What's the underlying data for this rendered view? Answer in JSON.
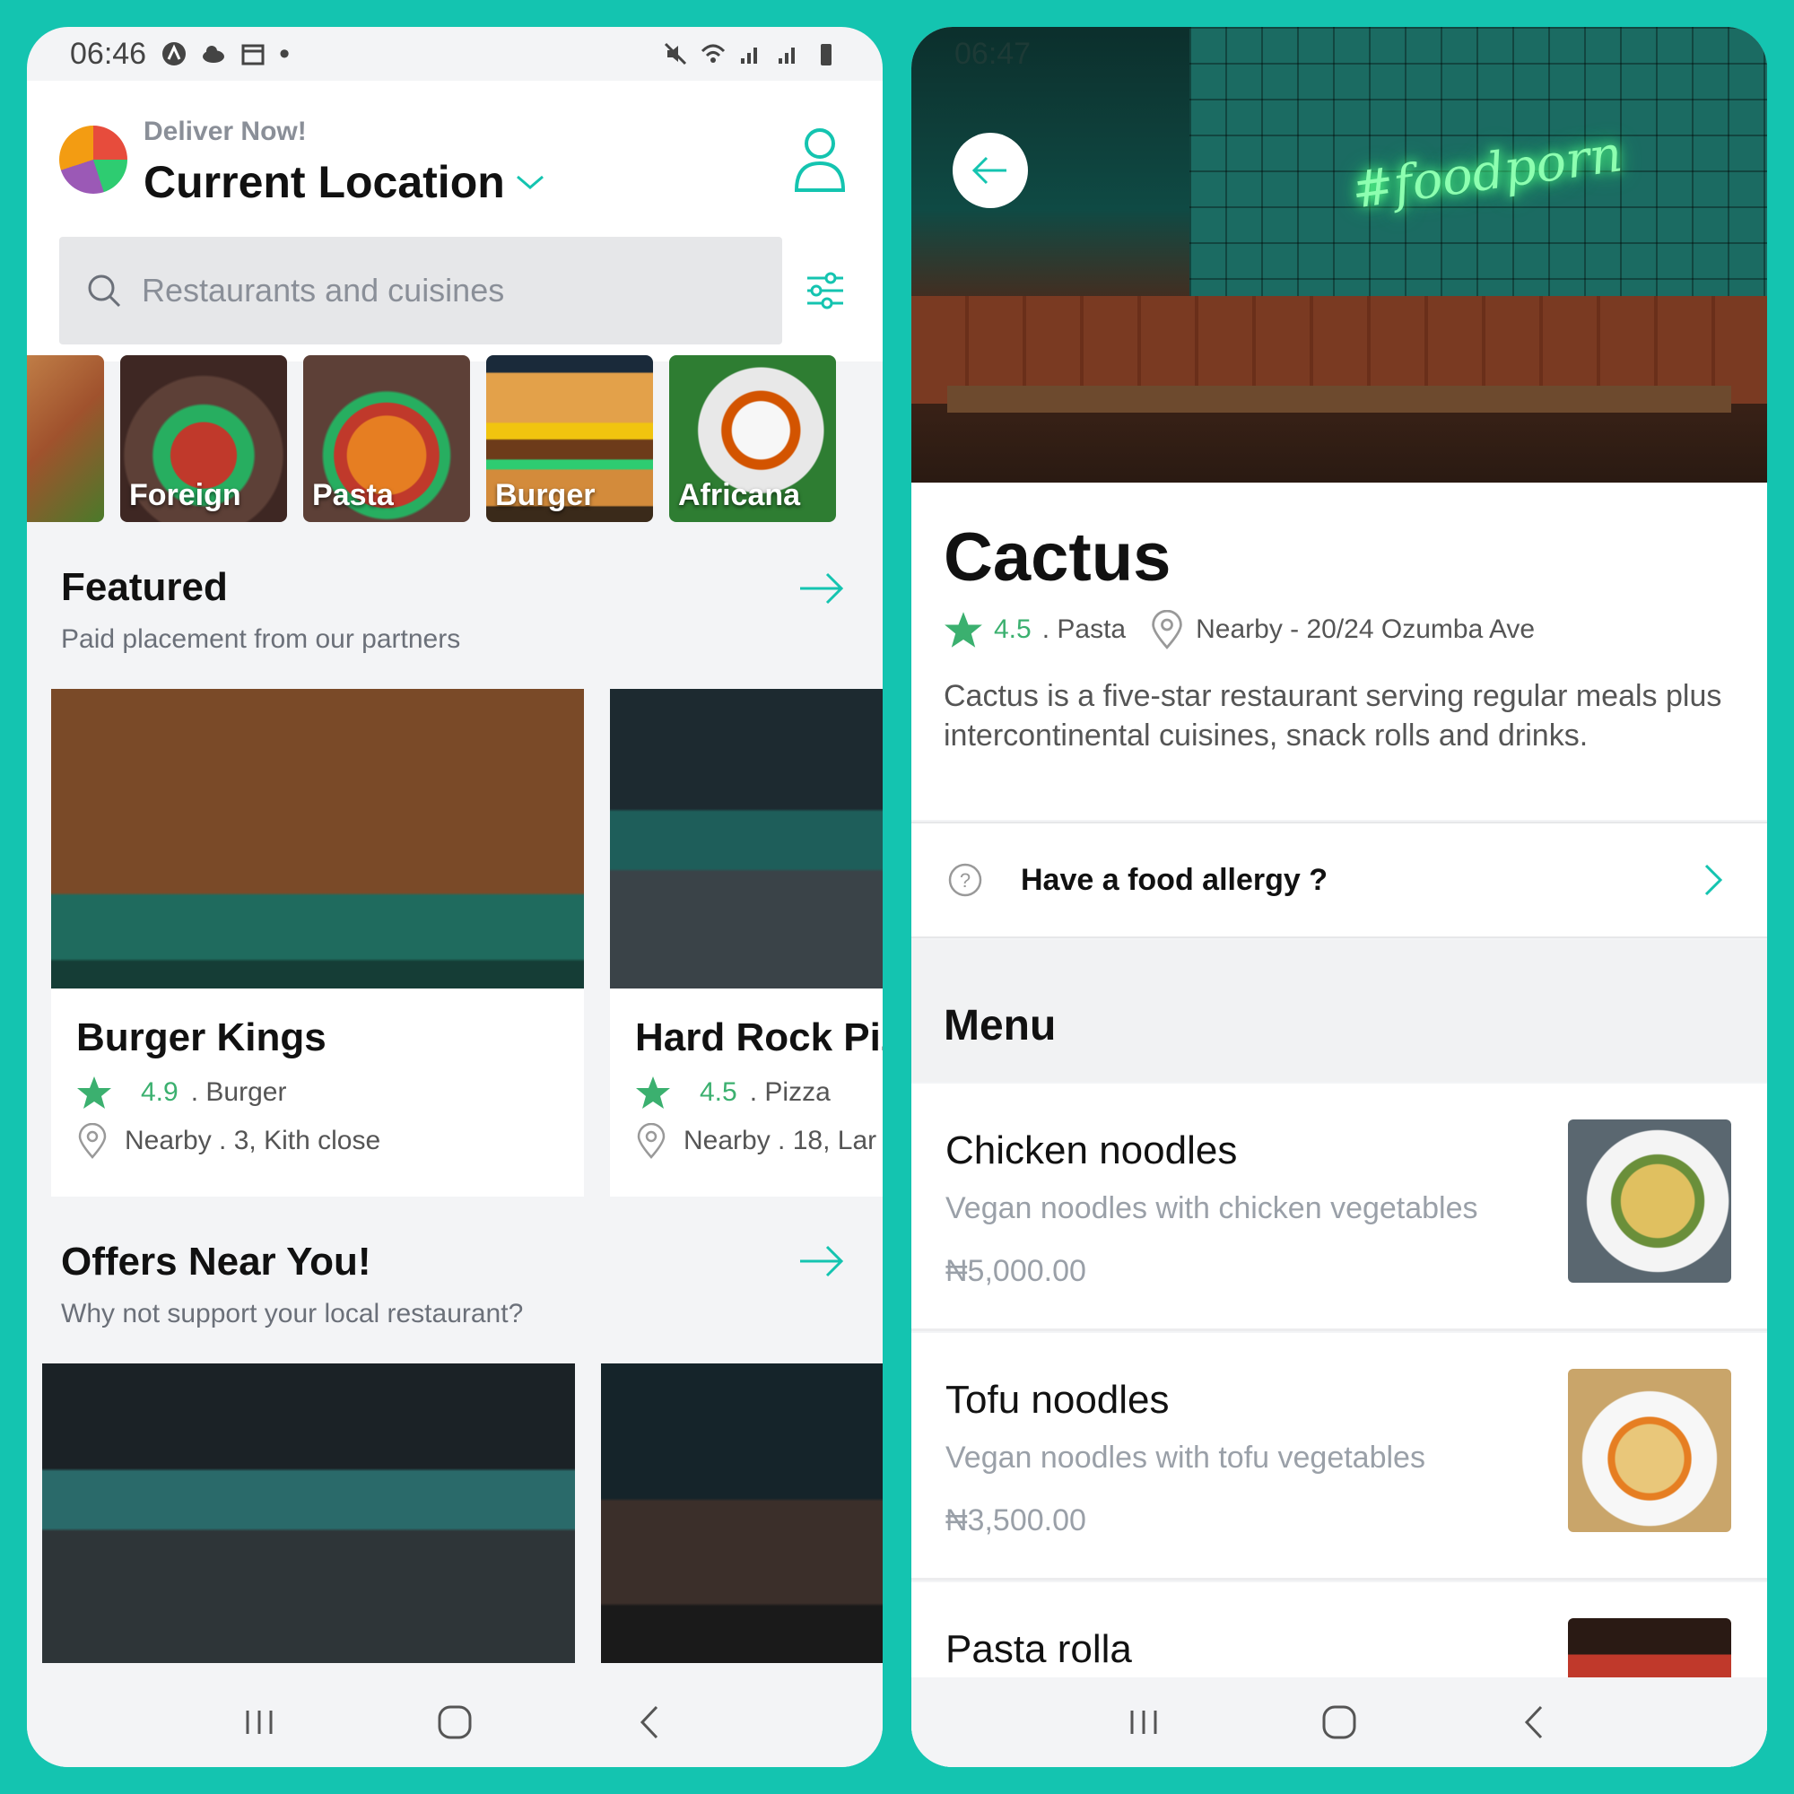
{
  "left": {
    "status": {
      "time": "06:46"
    },
    "header": {
      "deliver_label": "Deliver Now!",
      "location_label": "Current Location",
      "search_placeholder": "Restaurants and cuisines"
    },
    "categories": [
      {
        "label": ""
      },
      {
        "label": "Foreign"
      },
      {
        "label": "Pasta"
      },
      {
        "label": "Burger"
      },
      {
        "label": "Africana"
      }
    ],
    "featured": {
      "title": "Featured",
      "subtitle": "Paid placement from our partners",
      "cards": [
        {
          "name": "Burger Kings",
          "rating": "4.9",
          "cuisine": ". Burger",
          "address": "Nearby . 3, Kith close"
        },
        {
          "name": "Hard Rock Pizza",
          "rating": "4.5",
          "cuisine": ". Pizza",
          "address": "Nearby . 18, Lar"
        }
      ]
    },
    "offers": {
      "title": "Offers Near You!",
      "subtitle": "Why not support your local restaurant?"
    }
  },
  "right": {
    "status": {
      "time": "06:47"
    },
    "hero_sign": "#foodporn",
    "restaurant": {
      "name": "Cactus",
      "rating": "4.5",
      "cuisine": ". Pasta",
      "address": "Nearby - 20/24 Ozumba Ave",
      "description": "Cactus is a five-star restaurant serving regular meals plus intercontinental cuisines, snack rolls and drinks."
    },
    "allergy_label": "Have a food allergy ?",
    "menu_title": "Menu",
    "menu_items": [
      {
        "name": "Chicken noodles",
        "desc": "Vegan noodles with chicken vegetables",
        "price": "₦5,000.00"
      },
      {
        "name": "Tofu noodles",
        "desc": "Vegan noodles with tofu vegetables",
        "price": "₦3,500.00"
      },
      {
        "name": "Pasta rolla",
        "desc": "",
        "price": ""
      }
    ]
  },
  "colors": {
    "accent": "#14c4b0",
    "rating": "#3bb06f"
  }
}
